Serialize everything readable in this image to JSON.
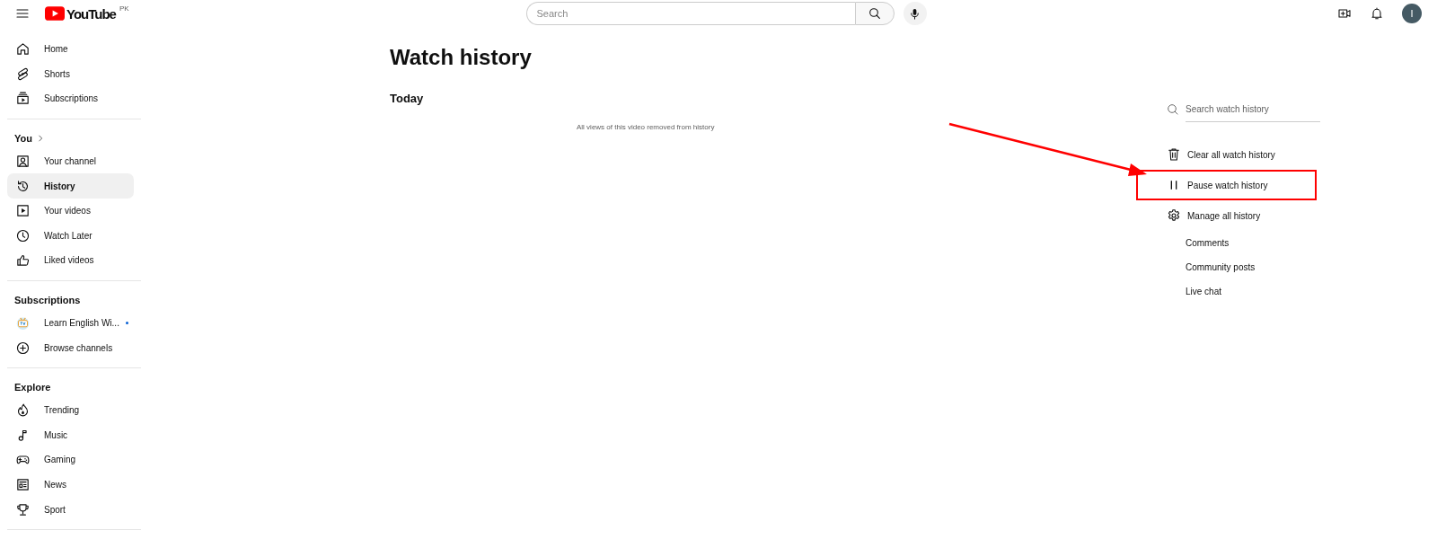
{
  "header": {
    "logo": "YouTube",
    "country": "PK",
    "search": {
      "placeholder": "Search"
    },
    "avatar": "I"
  },
  "sidebar": {
    "sections": [
      {
        "items": [
          {
            "label": "Home",
            "selected": false
          },
          {
            "label": "Shorts",
            "selected": false
          },
          {
            "label": "Subscriptions",
            "selected": false
          }
        ]
      },
      {
        "heading": "You",
        "items": [
          {
            "label": "Your channel",
            "selected": false
          },
          {
            "label": "History",
            "selected": true
          },
          {
            "label": "Your videos",
            "selected": false
          },
          {
            "label": "Watch Later",
            "selected": false
          },
          {
            "label": "Liked videos",
            "selected": false
          }
        ]
      },
      {
        "heading": "Subscriptions",
        "items": [
          {
            "label": "Learn English Wi...",
            "selected": false,
            "new_content": true
          },
          {
            "label": "Browse channels",
            "selected": false,
            "new_content": false
          }
        ]
      },
      {
        "heading": "Explore",
        "items": [
          {
            "label": "Trending",
            "selected": false
          },
          {
            "label": "Music",
            "selected": false
          },
          {
            "label": "Gaming",
            "selected": false
          },
          {
            "label": "News",
            "selected": false
          },
          {
            "label": "Sport",
            "selected": false
          }
        ]
      }
    ]
  },
  "page": {
    "title": "Watch history",
    "groups": [
      {
        "heading": "Today",
        "notice": "All views of this video removed from history"
      }
    ]
  },
  "panel": {
    "search": {
      "placeholder": "Search watch history"
    },
    "actions": [
      {
        "label": "Clear all watch history",
        "highlighted": false
      },
      {
        "label": "Pause watch history",
        "highlighted": true
      },
      {
        "label": "Manage all history",
        "highlighted": false,
        "children": [
          {
            "label": "Comments"
          },
          {
            "label": "Community posts"
          },
          {
            "label": "Live chat"
          }
        ]
      }
    ]
  }
}
